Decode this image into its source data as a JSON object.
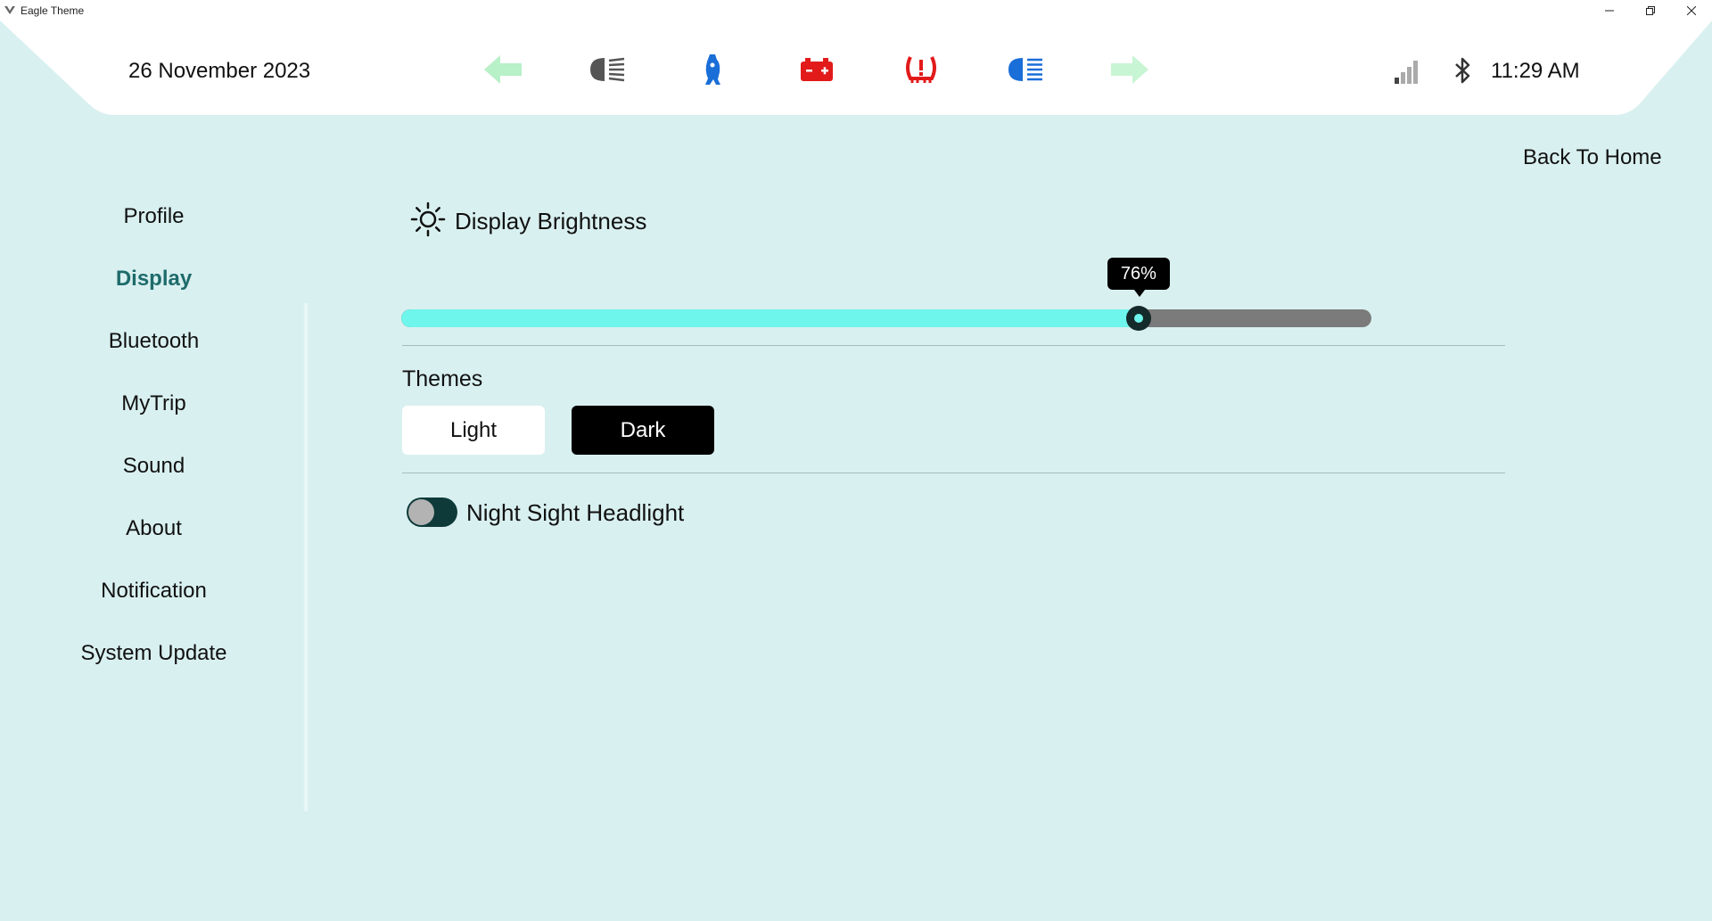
{
  "window": {
    "title": "Eagle Theme",
    "controls": [
      "minimize-icon",
      "restore-icon",
      "close-icon"
    ]
  },
  "header": {
    "date": "26 November 2023",
    "time": "11:29 AM",
    "indicators": [
      {
        "icon": "left-turn-signal-icon",
        "color": "#b8f0c8"
      },
      {
        "icon": "low-beam-headlight-icon",
        "color": "#555555"
      },
      {
        "icon": "kickstand-warning-icon",
        "color": "#1a6ed8"
      },
      {
        "icon": "battery-warning-icon",
        "color": "#e21a1a"
      },
      {
        "icon": "tire-pressure-warning-icon",
        "color": "#e21a1a"
      },
      {
        "icon": "high-beam-headlight-icon",
        "color": "#1a6ed8"
      },
      {
        "icon": "right-turn-signal-icon",
        "color": "#c8f5d4"
      }
    ],
    "status_icons": [
      "signal-strength-icon",
      "bluetooth-icon"
    ]
  },
  "back_home": "Back To Home",
  "sidebar": {
    "items": [
      {
        "label": "Profile",
        "active": false
      },
      {
        "label": "Display",
        "active": true
      },
      {
        "label": "Bluetooth",
        "active": false
      },
      {
        "label": "MyTrip",
        "active": false
      },
      {
        "label": "Sound",
        "active": false
      },
      {
        "label": "About",
        "active": false
      },
      {
        "label": "Notification",
        "active": false
      },
      {
        "label": "System Update",
        "active": false
      }
    ]
  },
  "display": {
    "brightness_title": "Display Brightness",
    "brightness_value": 76,
    "brightness_label": "76%",
    "themes_label": "Themes",
    "theme_light": "Light",
    "theme_dark": "Dark",
    "selected_theme": "Dark",
    "night_sight_label": "Night Sight Headlight",
    "night_sight_enabled": false
  },
  "colors": {
    "background": "#d9f0f0",
    "accent": "#6ef5ec",
    "active_nav": "#1e6b6b"
  }
}
